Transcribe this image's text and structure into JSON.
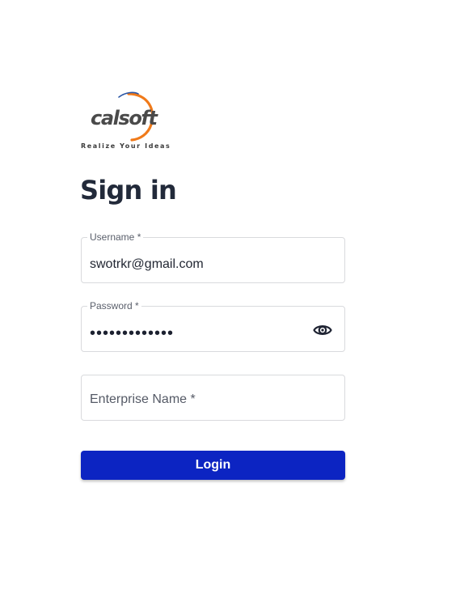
{
  "brand": {
    "logo_text": "calsoft",
    "tagline": "Realize Your Ideas",
    "colors": {
      "logo_text": "#4a4a4a",
      "logo_swoosh": "#f07a1a",
      "logo_swoosh_secondary": "#2a56a6"
    }
  },
  "page": {
    "title": "Sign in"
  },
  "form": {
    "username": {
      "label": "Username *",
      "value": "swotrkr@gmail.com"
    },
    "password": {
      "label": "Password *",
      "value_masked": "•••••••••••••",
      "toggle_icon": "eye-icon"
    },
    "enterprise": {
      "placeholder": "Enterprise Name *",
      "value": ""
    },
    "login_button": {
      "label": "Login",
      "color": "#0c24c2"
    }
  }
}
